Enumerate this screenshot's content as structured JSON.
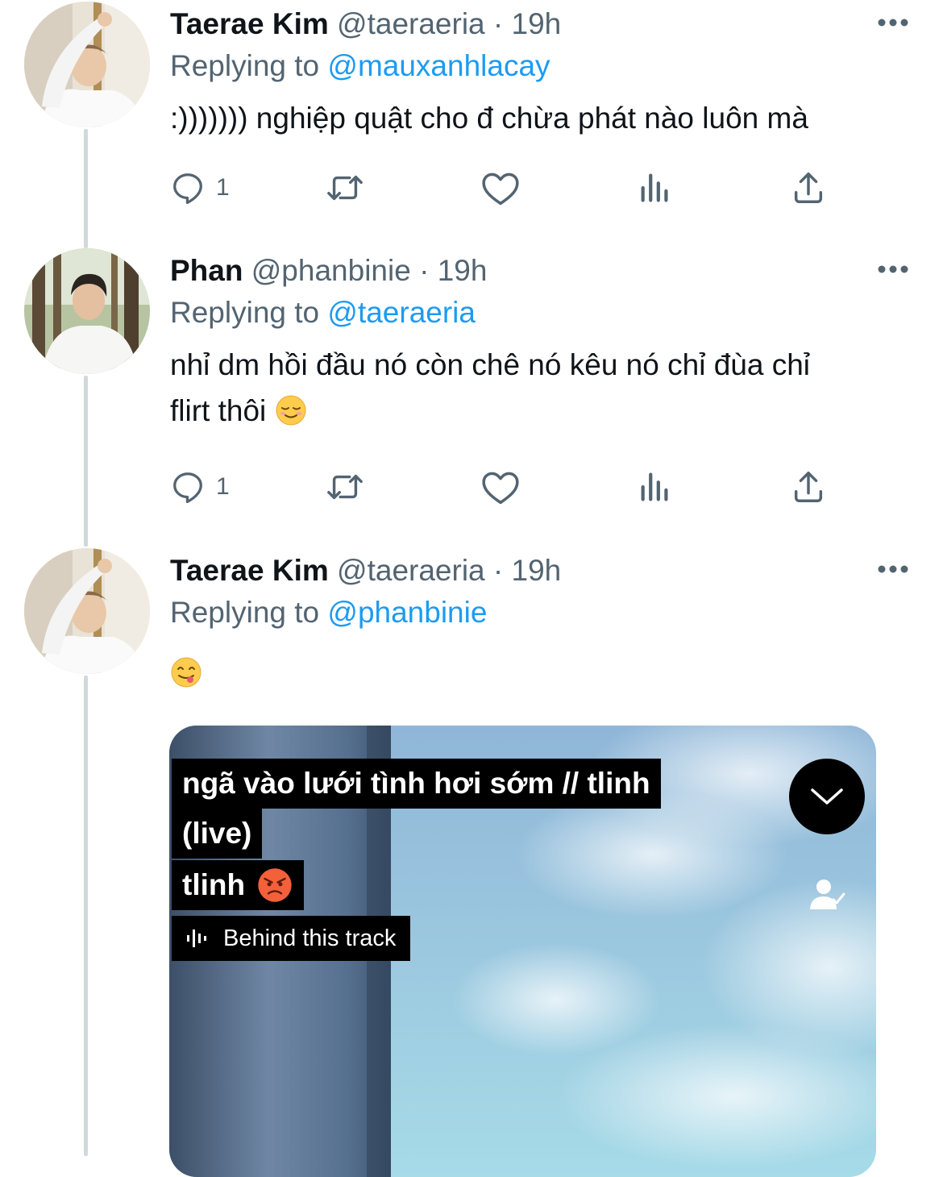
{
  "colors": {
    "text": "#0f1419",
    "secondary": "#536471",
    "accent": "#1d9bf0",
    "thread_line": "#cfd9de"
  },
  "tweets": [
    {
      "name": "Taerae Kim",
      "handle": "@taeraeria",
      "separator": "·",
      "time": "19h",
      "replying_prefix": "Replying to",
      "replying_to": "@mauxanhlacay",
      "text": ":))))))) nghiệp quật cho đ chừa phát nào luôn mà",
      "reply_count": "1",
      "icons": [
        "reply-icon",
        "retweet-icon",
        "like-icon",
        "analytics-icon",
        "share-icon",
        "more-icon"
      ]
    },
    {
      "name": "Phan",
      "handle": "@phanbinie",
      "separator": "·",
      "time": "19h",
      "replying_prefix": "Replying to",
      "replying_to": "@taeraeria",
      "text_line1": "nhỉ dm hồi đầu nó còn chê nó kêu nó chỉ đùa chỉ",
      "text_line2": "flirt thôi",
      "emoji": "relieved-face-emoji",
      "reply_count": "1"
    },
    {
      "name": "Taerae Kim",
      "handle": "@taeraeria",
      "separator": "·",
      "time": "19h",
      "replying_prefix": "Replying to",
      "replying_to": "@phanbinie",
      "emoji": "face-savoring-food-emoji",
      "media": {
        "title_line1": "ngã vào lưới tình hơi sớm // tlinh",
        "title_line2": "(live)",
        "artist": "tlinh",
        "artist_emoji": "pouting-face-emoji",
        "behind_label": "Behind this track",
        "icons": [
          "audio-wave-icon",
          "chevron-down-icon",
          "follow-user-icon"
        ]
      }
    }
  ]
}
